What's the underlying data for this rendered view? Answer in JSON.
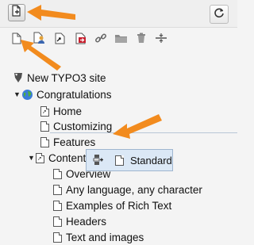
{
  "toolbar": {
    "new_page_icon": "new-page-icon",
    "refresh_icon": "refresh-icon"
  },
  "page_icons": [
    "page-icon",
    "user-page-icon",
    "shortcut-page-icon",
    "external-link-icon",
    "link-icon",
    "folder-icon",
    "trash-icon",
    "divider-icon"
  ],
  "tree": {
    "site": "New TYPO3 site",
    "pages": [
      {
        "label": "Congratulations"
      },
      {
        "label": "Home"
      },
      {
        "label": "Customizing"
      },
      {
        "label": "Features"
      },
      {
        "label": "Content"
      },
      {
        "label": "Overview"
      },
      {
        "label": "Any language, any character"
      },
      {
        "label": "Examples of Rich Text"
      },
      {
        "label": "Headers"
      },
      {
        "label": "Text and images"
      }
    ]
  },
  "popup": {
    "label": "Standard"
  },
  "colors": {
    "accent_arrow": "#f28b1e",
    "typo3_orange": "#f49700",
    "popup_bg": "#dbe8f6"
  }
}
